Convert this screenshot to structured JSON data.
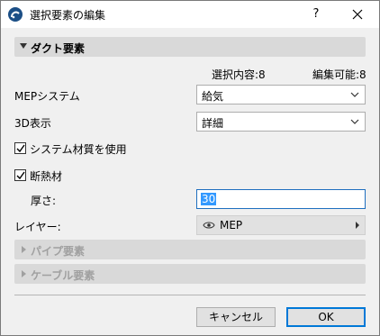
{
  "window": {
    "title": "選択要素の編集",
    "help_label": "?"
  },
  "sections": {
    "duct": {
      "label": "ダクト要素",
      "expanded": true
    },
    "pipe": {
      "label": "パイプ要素",
      "expanded": false
    },
    "cable": {
      "label": "ケーブル要素",
      "expanded": false
    }
  },
  "stats": {
    "selected": "選択内容:8",
    "editable": "編集可能:8"
  },
  "fields": {
    "mep_system": {
      "label": "MEPシステム",
      "value": "給気"
    },
    "view_3d": {
      "label": "3D表示",
      "value": "詳細"
    },
    "use_system_material": {
      "label": "システム材質を使用",
      "checked": true
    },
    "insulation": {
      "label": "断熱材",
      "checked": true
    },
    "thickness": {
      "label": "厚さ:",
      "value": "30"
    },
    "layer": {
      "label": "レイヤー:",
      "value": "MEP"
    }
  },
  "buttons": {
    "cancel": "キャンセル",
    "ok": "OK"
  },
  "colors": {
    "accent": "#0078d7",
    "selection": "#3399ff",
    "section_bg": "#d9d9d9"
  }
}
